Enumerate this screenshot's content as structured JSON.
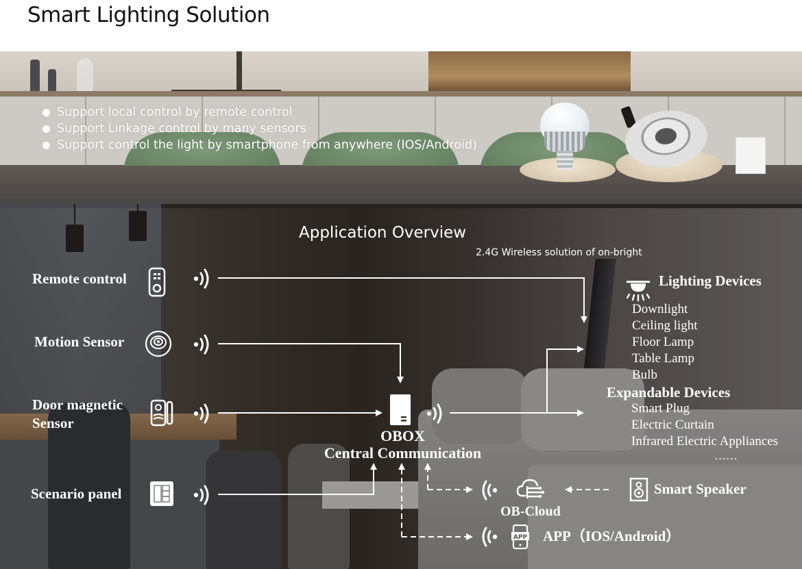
{
  "page": {
    "title": "Smart Lighting Solution"
  },
  "banner": {
    "bullets": [
      "Support local control  by remote control",
      "Support  Linkage control by many sensors",
      "Support control the light by smartphone from anywhere (IOS/Android)"
    ],
    "products": [
      "led-bulb",
      "led-downlight",
      "obox-hub"
    ]
  },
  "overview": {
    "title": "Application Overview",
    "subtitle": "2.4G Wireless solution of on-bright"
  },
  "sources": [
    {
      "label": "Remote control",
      "icon": "remote-control-icon"
    },
    {
      "label": "Motion Sensor",
      "icon": "motion-sensor-icon"
    },
    {
      "label_line1": "Door magnetic",
      "label_line2": "Sensor",
      "icon": "door-sensor-icon"
    },
    {
      "label": "Scenario panel",
      "icon": "scenario-panel-icon"
    }
  ],
  "hub": {
    "name": "OBOX",
    "role": "Central Communication",
    "icon": "obox-icon"
  },
  "lighting_devices": {
    "heading": "Lighting Devices",
    "icon": "ceiling-light-icon",
    "items": [
      "Downlight",
      "Ceiling light",
      "Floor Lamp",
      "Table Lamp",
      "Bulb"
    ]
  },
  "expandable_devices": {
    "heading": "Expandable Devices",
    "items": [
      "Smart Plug",
      "Electric Curtain",
      "Infrared Electric Appliances"
    ],
    "more": "……"
  },
  "cloud": {
    "label": "OB-Cloud",
    "icon": "cloud-icon"
  },
  "smart_speaker": {
    "label": "Smart Speaker",
    "icon": "speaker-icon"
  },
  "app": {
    "label": "APP（IOS/Android）",
    "icon": "app-phone-icon",
    "icon_text": "APP"
  },
  "colors": {
    "text_on_image": "#ffffff",
    "title": "#111111",
    "connector": "#ffffff"
  }
}
